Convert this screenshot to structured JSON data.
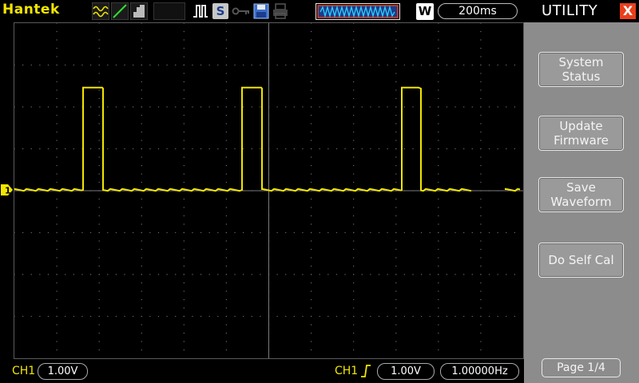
{
  "top_bar": {
    "brand": "Hantek",
    "status_badge": "S",
    "memory_badge": "W",
    "timebase": "200ms",
    "icons": [
      "channel-waveform-icon",
      "trigger-slope-icon",
      "acquire-mode-icon",
      "pulse-trigger-icon",
      "stop-status-badge",
      "key-lock-icon",
      "save-disk-icon",
      "print-icon",
      "memory-window-icon"
    ]
  },
  "colors": {
    "channel1": "#f2e600",
    "menu_bg": "#8c8c8c",
    "close": "#e8401c",
    "grid": "#6a6a6a"
  },
  "channel": {
    "marker": "1"
  },
  "bottom_bar": {
    "ch1_label": "CH1",
    "ch1_scale": "1.00V",
    "trigger_source": "CH1",
    "trigger_level": "1.00V",
    "frequency": "1.00000Hz"
  },
  "menu": {
    "title": "UTILITY",
    "close_label": "X",
    "buttons": [
      {
        "label": "System\nStatus"
      },
      {
        "label": "Update\nFirmware"
      },
      {
        "label": "Save\nWaveform"
      },
      {
        "label": "Do Self Cal"
      }
    ],
    "page": "Page 1/4"
  }
}
